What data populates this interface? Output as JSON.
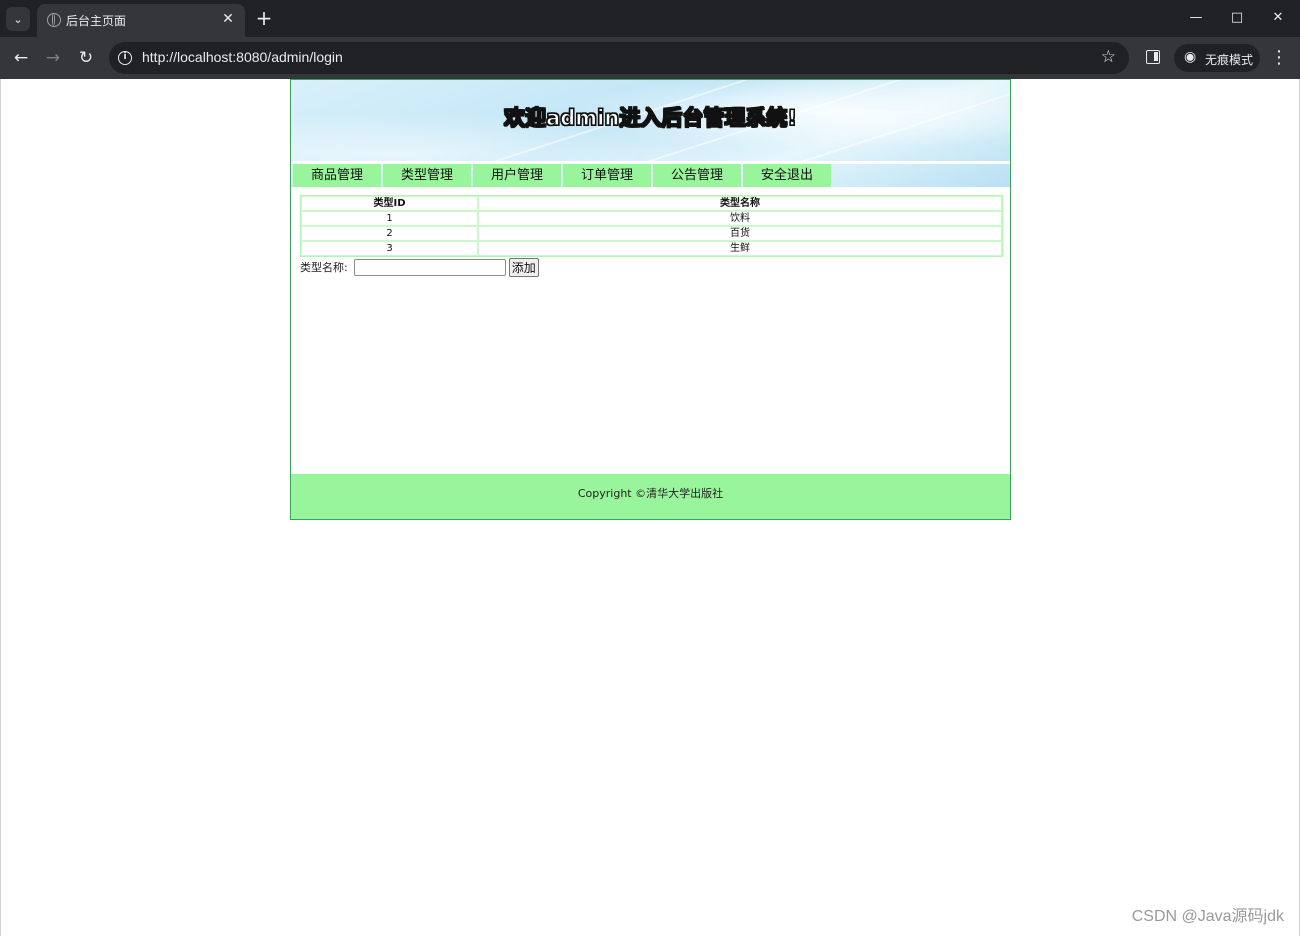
{
  "browser": {
    "tab_title": "后台主页面",
    "url": "http://localhost:8080/admin/login",
    "incognito_label": "无痕模式"
  },
  "banner": {
    "title": "欢迎admin进入后台管理系统!"
  },
  "menu": [
    {
      "label": "商品管理"
    },
    {
      "label": "类型管理"
    },
    {
      "label": "用户管理"
    },
    {
      "label": "订单管理"
    },
    {
      "label": "公告管理"
    },
    {
      "label": "安全退出"
    }
  ],
  "table": {
    "headers": [
      "类型ID",
      "类型名称"
    ],
    "rows": [
      [
        "1",
        "饮料"
      ],
      [
        "2",
        "百货"
      ],
      [
        "3",
        "生鲜"
      ]
    ]
  },
  "add_form": {
    "label": "类型名称:",
    "input_value": "",
    "button_label": "添加"
  },
  "footer": {
    "text": "Copyright ©清华大学出版社"
  },
  "watermark": "CSDN @Java源码jdk",
  "colors": {
    "menu_bg": "#99f59b",
    "footer_bg": "#99f59b",
    "page_border": "#3aa35a",
    "chrome_dark": "#202124",
    "chrome_toolbar": "#35363a"
  }
}
